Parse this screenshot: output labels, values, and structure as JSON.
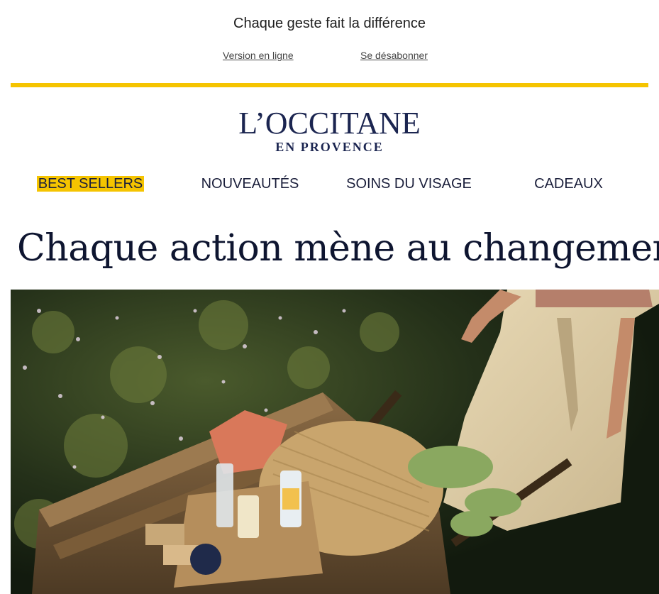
{
  "preheader": {
    "text": "Chaque geste fait la différence",
    "online_link": "Version en ligne",
    "unsubscribe_link": "Se désabonner"
  },
  "brand": {
    "name": "L’OCCITANE",
    "tagline": "EN PROVENCE",
    "accent_color": "#f5c400",
    "brand_color": "#1b2550"
  },
  "nav": {
    "items": [
      {
        "label": "BEST SELLERS",
        "highlighted": true
      },
      {
        "label": "NOUVEAUTÉS",
        "highlighted": false
      },
      {
        "label": "SOINS DU VISAGE",
        "highlighted": false
      },
      {
        "label": "CADEAUX",
        "highlighted": false
      }
    ]
  },
  "hero": {
    "headline": "Chaque action mène au changement",
    "image_icon": "wheelbarrow-photo"
  }
}
